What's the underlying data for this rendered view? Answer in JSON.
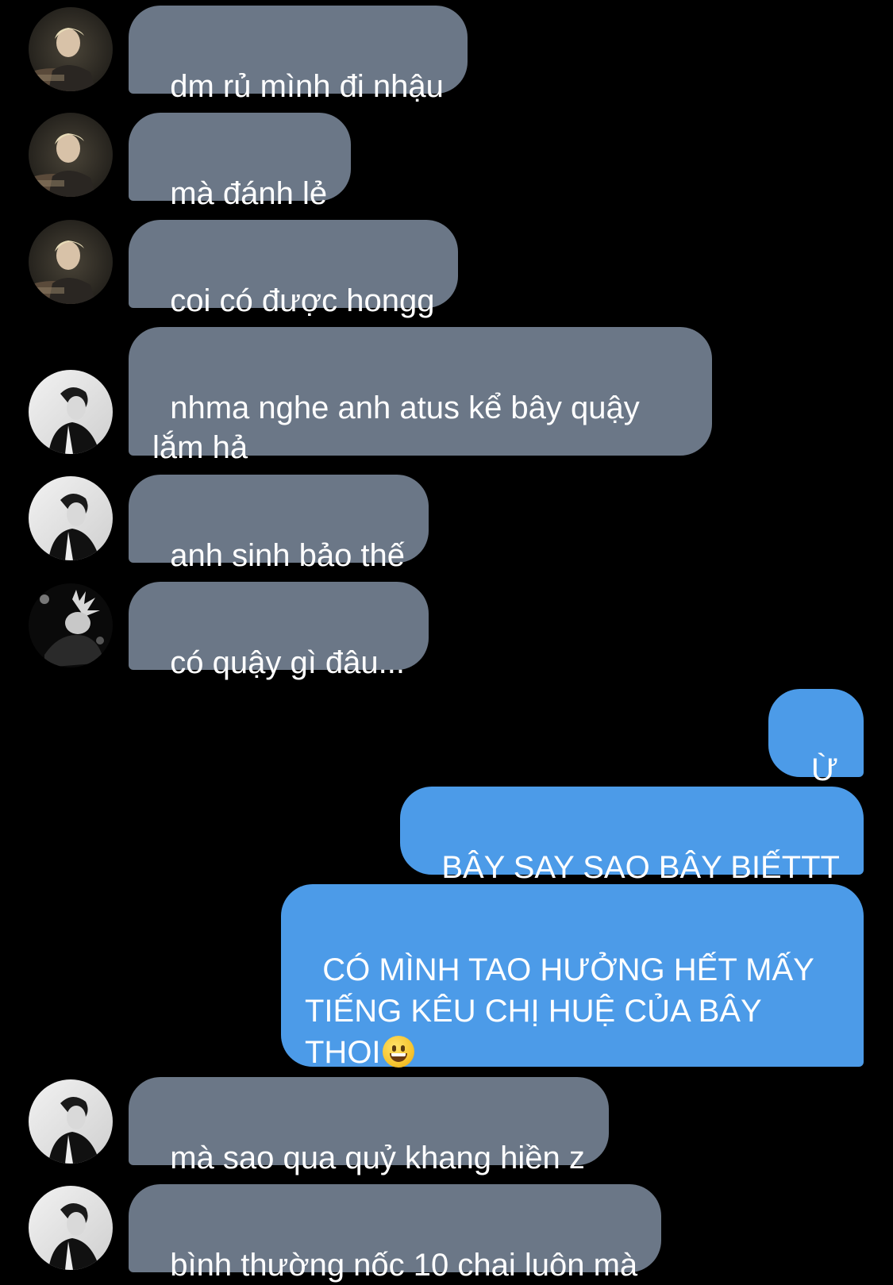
{
  "conversation": {
    "messages": [
      {
        "side": "incoming",
        "text": "dm rủ mình đi nhậu",
        "avatar": "avatar-blond"
      },
      {
        "side": "incoming",
        "text": "mà đánh lẻ",
        "avatar": "avatar-blond"
      },
      {
        "side": "incoming",
        "text": "coi có được hongg",
        "avatar": "avatar-blond"
      },
      {
        "side": "incoming",
        "text": "nhma nghe anh atus kể bây quậy lắm hả",
        "avatar": "avatar-bw"
      },
      {
        "side": "incoming",
        "text": "anh sinh bảo thế",
        "avatar": "avatar-bw"
      },
      {
        "side": "incoming",
        "text": "có quậy gì đâu...",
        "avatar": "avatar-dark"
      },
      {
        "side": "outgoing",
        "text": "Ừ"
      },
      {
        "side": "outgoing",
        "text": "BÂY SAY SAO BÂY BIẾTTT"
      },
      {
        "side": "outgoing",
        "text": "CÓ MÌNH TAO HƯỞNG HẾT MẤY TIẾNG KÊU CHỊ HUỆ CỦA BÂY THOI",
        "emoji": "grinning-face-emoji"
      },
      {
        "side": "incoming",
        "text": "mà sao qua quỷ khang hiền z",
        "avatar": "avatar-bw"
      },
      {
        "side": "incoming",
        "text": "bình thường nốc 10 chai luôn mà",
        "avatar": "avatar-bw"
      }
    ]
  },
  "colors": {
    "background": "#000000",
    "incoming_bubble": "#6b7787",
    "outgoing_bubble": "#4c9be8",
    "text": "#ffffff"
  }
}
